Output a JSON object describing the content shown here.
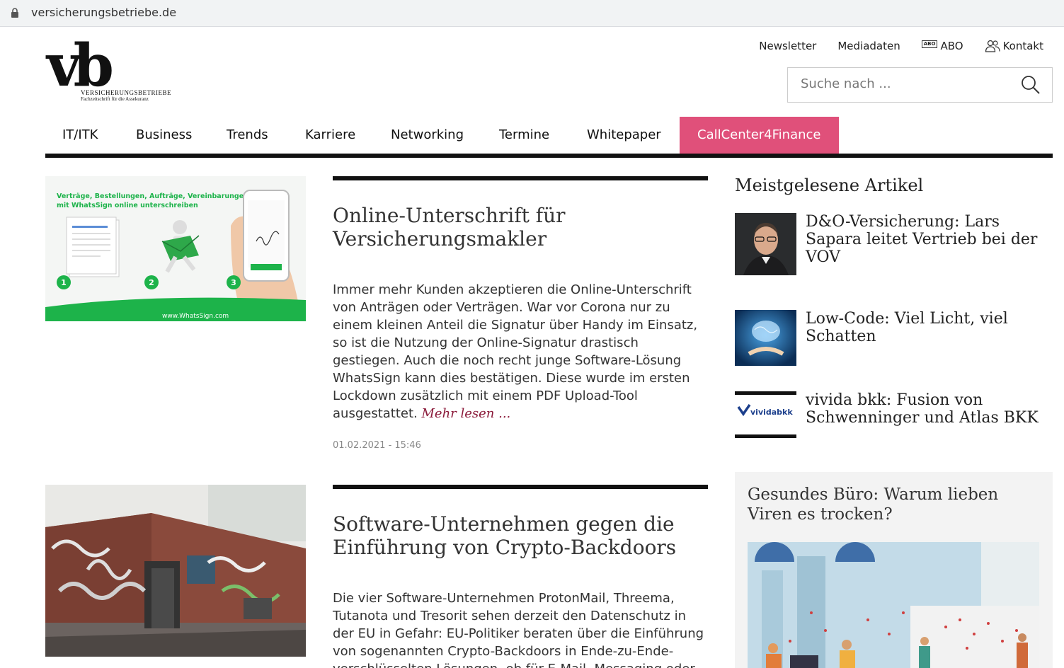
{
  "browser": {
    "url": "versicherungsbetriebe.de"
  },
  "logo": {
    "mark": "vb",
    "tagline": "VERSICHERUNGSBETRIEBE",
    "subtagline": "Fachzeitschrift für die Assekuranz"
  },
  "toplinks": {
    "newsletter": "Newsletter",
    "mediadaten": "Mediadaten",
    "abo_badge": "ABO",
    "abo": "ABO",
    "kontakt": "Kontakt"
  },
  "search": {
    "placeholder": "Suche nach ..."
  },
  "nav": {
    "items": [
      "IT/ITK",
      "Business",
      "Trends",
      "Karriere",
      "Networking",
      "Termine",
      "Whitepaper"
    ],
    "highlight": "CallCenter4Finance"
  },
  "articles": [
    {
      "title": "Online-Unterschrift für Versicherungsmakler",
      "teaser": "Immer mehr Kunden akzeptieren die Online-Unterschrift von Anträgen oder Verträgen. War vor Corona nur zu einem kleinen Anteil die Signatur über Handy im Einsatz, so ist die Nutzung der Online-Signatur drastisch gestiegen. Auch die noch recht junge Software-Lösung WhatsSign kann dies bestätigen. Diese wurde im ersten Lockdown zusätzlich mit einem PDF Upload-Tool ausgestattet.",
      "more": "Mehr lesen ...",
      "date": "01.02.2021 - 15:46",
      "image": {
        "headline1": "Verträge, Bestellungen, Aufträge, Vereinbarungen",
        "headline2": "mit WhatsSign online unterschreiben",
        "steps": [
          "1",
          "2",
          "3"
        ],
        "url": "www.WhatsSign.com"
      }
    },
    {
      "title": "Software-Unternehmen gegen die Einführung von Crypto-Backdoors",
      "teaser": "Die vier Software-Unternehmen ProtonMail, Threema, Tutanota und Tresorit sehen derzeit den Datenschutz in der EU in Gefahr: EU-Politiker beraten über die Einführung von sogenannten Crypto-Backdoors in Ende-zu-Ende-verschlüsselten Lösungen, ob für E-Mail, Messaging oder"
    }
  ],
  "sidebar": {
    "title": "Meistgelesene Artikel",
    "items": [
      {
        "title": "D&O-Versicherung: Lars Sapara leitet Vertrieb bei der VOV"
      },
      {
        "title": "Low-Code: Viel Licht, viel Schatten"
      },
      {
        "title": "vivida bkk: Fusion von Schwenninger und Atlas BKK",
        "logo_text": "vividabkk"
      }
    ],
    "featured": {
      "title": "Gesundes Büro: Warum lieben Viren es trocken?"
    }
  },
  "colors": {
    "accent": "#e0507a",
    "more_link": "#8b1a3a",
    "whatssign_green": "#1db34a"
  }
}
